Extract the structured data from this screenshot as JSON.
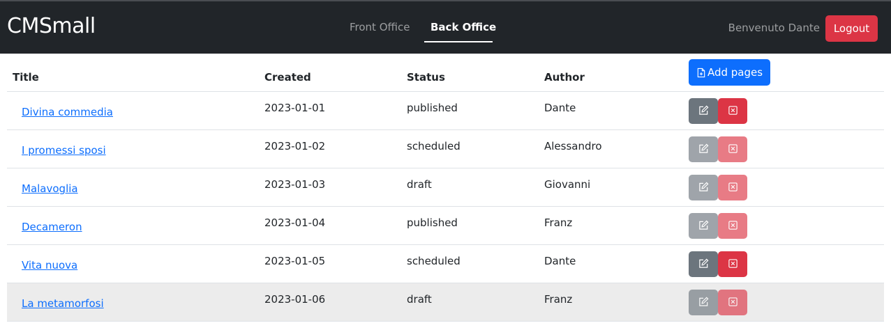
{
  "navbar": {
    "brand": "CMSmall",
    "links": [
      "Front Office",
      "Back Office"
    ],
    "active_link": "Back Office",
    "welcome": "Benvenuto Dante",
    "logout_label": "Logout"
  },
  "table": {
    "headers": {
      "title": "Title",
      "created": "Created",
      "status": "Status",
      "author": "Author"
    },
    "add_label": "Add pages",
    "rows": [
      {
        "title": "Divina commedia",
        "created": "2023-01-01",
        "status": "published",
        "author": "Dante",
        "actions_enabled": true
      },
      {
        "title": "I promessi sposi",
        "created": "2023-01-02",
        "status": "scheduled",
        "author": "Alessandro",
        "actions_enabled": false
      },
      {
        "title": "Malavoglia",
        "created": "2023-01-03",
        "status": "draft",
        "author": "Giovanni",
        "actions_enabled": false
      },
      {
        "title": "Decameron",
        "created": "2023-01-04",
        "status": "published",
        "author": "Franz",
        "actions_enabled": false
      },
      {
        "title": "Vita nuova",
        "created": "2023-01-05",
        "status": "scheduled",
        "author": "Dante",
        "actions_enabled": true
      },
      {
        "title": "La metamorfosi",
        "created": "2023-01-06",
        "status": "draft",
        "author": "Franz",
        "actions_enabled": false
      }
    ]
  },
  "colors": {
    "navbar_bg": "#212529",
    "primary": "#0d6efd",
    "danger": "#dc3545",
    "secondary": "#6c757d"
  },
  "icons": {
    "add": "file-plus-icon",
    "edit": "pencil-square-icon",
    "delete": "x-square-icon"
  }
}
